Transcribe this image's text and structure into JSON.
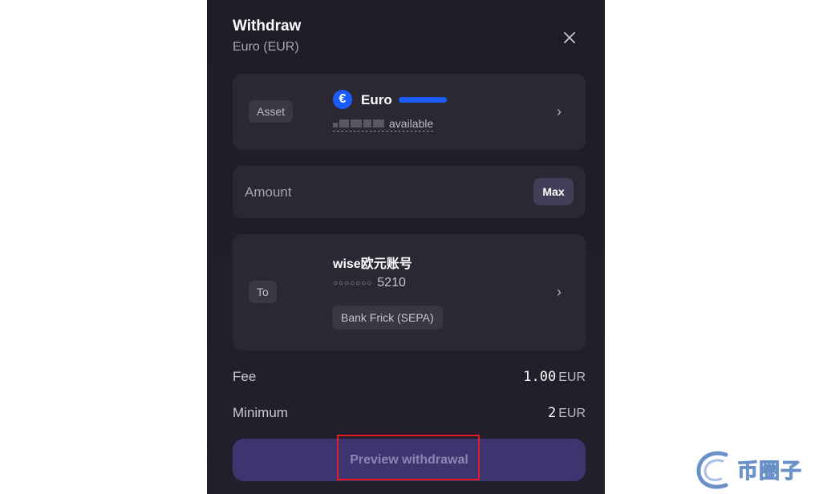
{
  "modal": {
    "title": "Withdraw",
    "subtitle": "Euro (EUR)",
    "close_icon": "close-icon"
  },
  "asset_card": {
    "chip": "Asset",
    "icon_glyph": "€",
    "name": "Euro",
    "available_suffix": "available",
    "chevron": "›",
    "accent": "#1a5cff"
  },
  "amount_card": {
    "placeholder": "Amount",
    "max_label": "Max"
  },
  "to_card": {
    "chip": "To",
    "account_name": "wise欧元账号",
    "account_dots": "○○○○○○○",
    "account_last4": "5210",
    "bank": "Bank Frick (SEPA)",
    "chevron": "›"
  },
  "fee": {
    "label": "Fee",
    "value": "1.00",
    "currency": "EUR"
  },
  "minimum": {
    "label": "Minimum",
    "value": "2",
    "currency": "EUR"
  },
  "preview_button": {
    "label": "Preview withdrawal",
    "color": "#3d3570"
  },
  "watermark": {
    "text": "币圈子"
  }
}
